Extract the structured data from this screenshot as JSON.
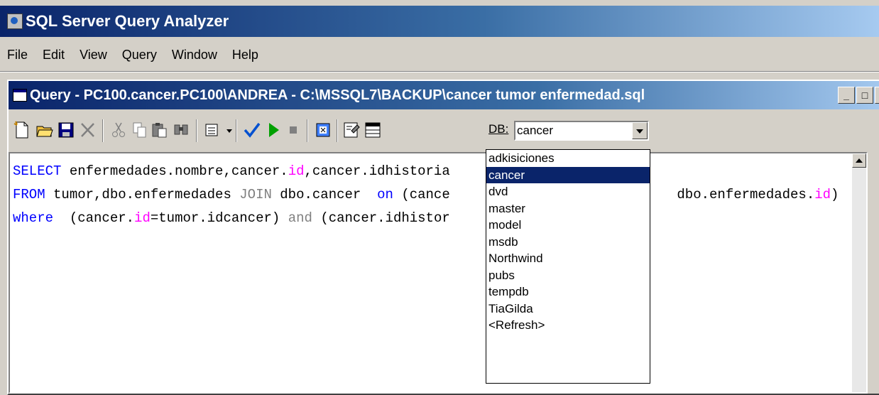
{
  "app": {
    "title": "SQL Server Query Analyzer"
  },
  "menu": [
    "File",
    "Edit",
    "View",
    "Query",
    "Window",
    "Help"
  ],
  "window": {
    "title": "Query - PC100.cancer.PC100\\ANDREA - C:\\MSSQL7\\BACKUP\\cancer tumor enfermedad.sql",
    "controls": {
      "minimize": "_",
      "restore": "□",
      "close": "X"
    }
  },
  "toolbar": {
    "icons": [
      "new-query-icon",
      "open-file-icon",
      "save-icon",
      "clear-window-icon",
      "cut-icon",
      "copy-icon",
      "paste-icon",
      "find-icon",
      "results-mode-icon",
      "parse-query-icon",
      "execute-query-icon",
      "cancel-query-icon",
      "show-plan-icon",
      "object-properties-icon",
      "results-pane-icon"
    ],
    "db_label": "DB:",
    "db_selected": "cancer"
  },
  "editor": {
    "line1": {
      "kw1": "SELECT",
      "t1": " enfermedades.nombre,cancer.",
      "id": "id",
      "t2": ",cancer.idhistoria"
    },
    "line2": {
      "kw1": "FROM",
      "t1": " tumor,dbo.enfermedades ",
      "join": "JOIN",
      "t2": " dbo.cancer  ",
      "on": "on",
      "t3": " (cance",
      "t4": " dbo.enfermedades.",
      "id": "id",
      "t5": ")"
    },
    "line3": {
      "kw1": "where",
      "t1": "  (cancer.",
      "id": "id",
      "t2": "=tumor.idcancer) ",
      "and": "and",
      "t3": " (cancer.idhistor"
    }
  },
  "dropdown": {
    "items": [
      "adkisiciones",
      "cancer",
      "dvd",
      "master",
      "model",
      "msdb",
      "Northwind",
      "pubs",
      "tempdb",
      "TiaGilda",
      "<Refresh>"
    ],
    "selected_index": 1
  }
}
